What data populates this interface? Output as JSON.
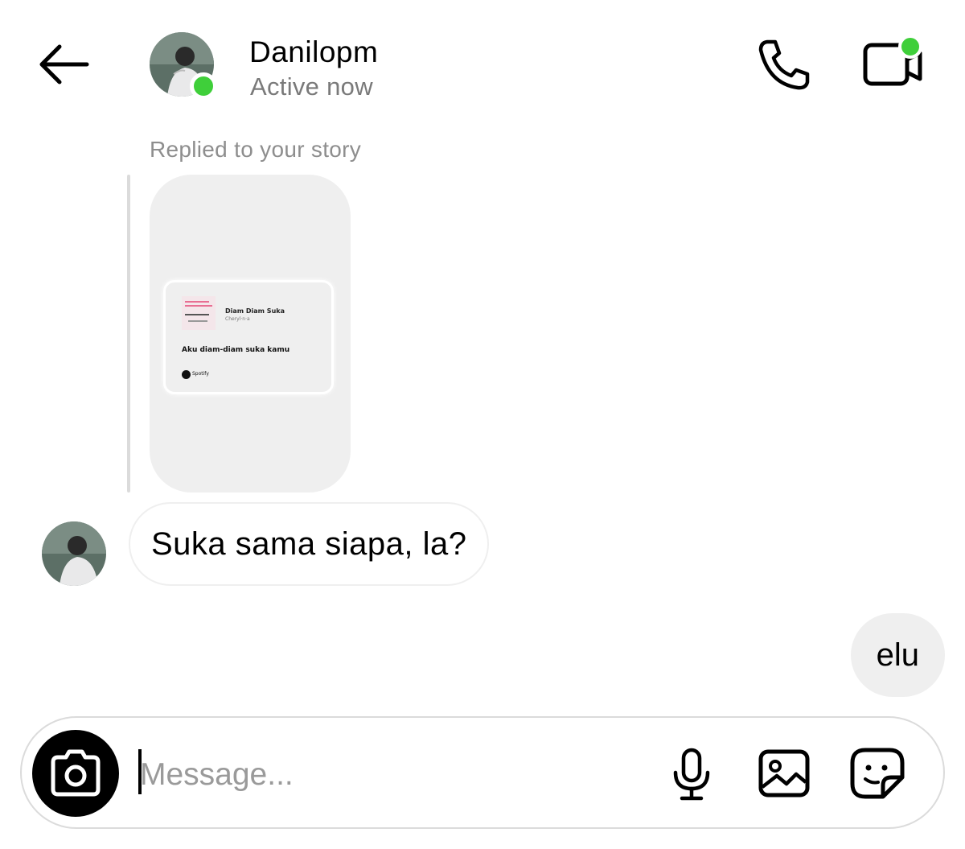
{
  "header": {
    "username": "Danilopm",
    "status": "Active now",
    "icons": {
      "back": "arrow-left-icon",
      "call": "phone-icon",
      "video": "video-camera-icon"
    }
  },
  "story_reply": {
    "label": "Replied to your story",
    "music_sticker": {
      "song_title": "Diam Diam Suka",
      "artist": "Cheryl·n·a",
      "lyric": "Aku diam-diam suka kamu",
      "platform": "Spotify"
    }
  },
  "messages": {
    "incoming": "Suka sama siapa, la?",
    "outgoing": "elu"
  },
  "composer": {
    "placeholder": "Message...",
    "icons": [
      "camera-icon",
      "microphone-icon",
      "gallery-icon",
      "sticker-icon"
    ]
  },
  "colors": {
    "online": "#3fcf3a",
    "bubble_out": "#efefef",
    "muted_text": "#8e8e8e"
  }
}
